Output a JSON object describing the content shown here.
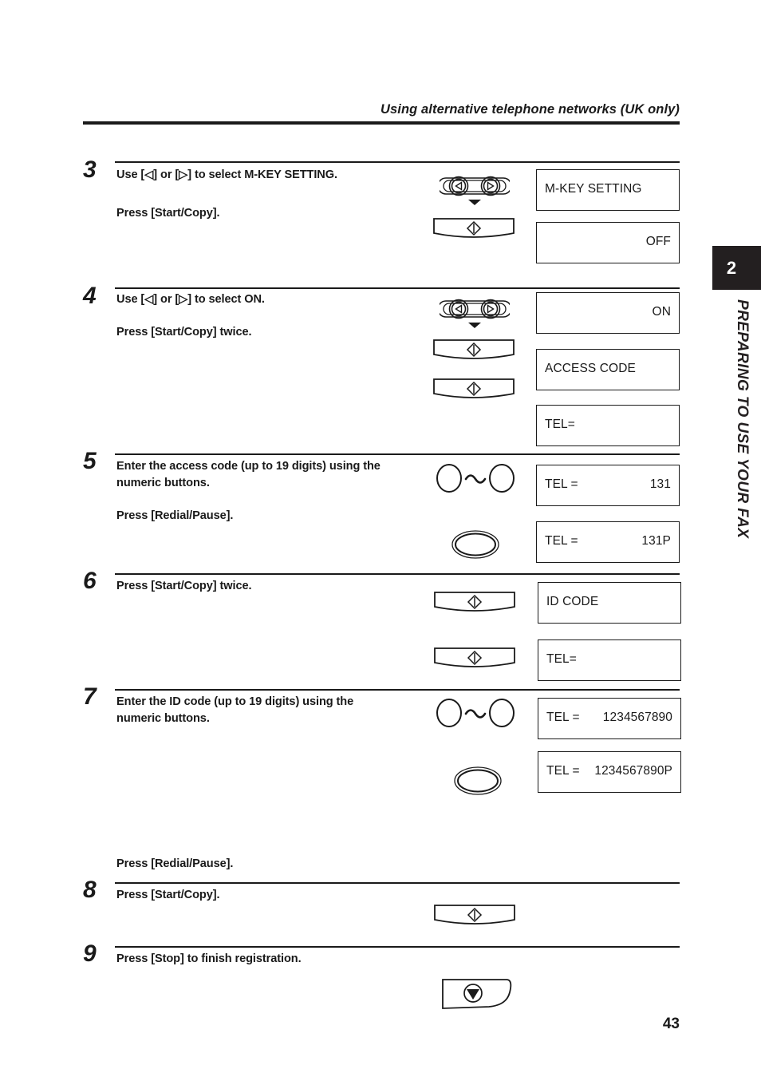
{
  "header": {
    "title": "Using alternative telephone networks (UK only)"
  },
  "side_tab": {
    "chapter_number": "2",
    "chapter_label": "PREPARING TO USE YOUR FAX"
  },
  "footer": {
    "page_number": "43"
  },
  "steps": [
    {
      "number": "3",
      "lines": [
        "Use [◁] or [▷] to select M-KEY SETTING.",
        "Press [Start/Copy]."
      ],
      "buttons": [
        "arrow-keys",
        "start-copy"
      ],
      "lcds": [
        {
          "left": "M-KEY SETTING",
          "right": ""
        },
        {
          "left": "",
          "right": "OFF"
        }
      ]
    },
    {
      "number": "4",
      "lines": [
        "Use [◁] or [▷] to select ON.",
        "Press [Start/Copy] twice."
      ],
      "buttons": [
        "arrow-keys",
        "start-copy",
        "start-copy"
      ],
      "lcds": [
        {
          "left": "",
          "right": "ON"
        },
        {
          "left": "ACCESS CODE",
          "right": ""
        },
        {
          "left": "TEL=",
          "right": ""
        }
      ]
    },
    {
      "number": "5",
      "lines": [
        "Enter the access code (up to 19 digits) using the",
        "numeric buttons.",
        "Press [Redial/Pause]."
      ],
      "buttons": [
        "numeric-keys",
        "redial-pause"
      ],
      "lcds": [
        {
          "left": "TEL =",
          "right": "131"
        },
        {
          "left": "TEL =",
          "right": "131P"
        }
      ]
    },
    {
      "number": "6",
      "lines": [
        "Press [Start/Copy] twice."
      ],
      "buttons": [
        "start-copy",
        "start-copy"
      ],
      "lcds": [
        {
          "left": "ID CODE",
          "right": ""
        },
        {
          "left": "TEL=",
          "right": ""
        }
      ]
    },
    {
      "number": "7",
      "lines": [
        "Enter the ID code (up to 19 digits) using the",
        "numeric buttons.",
        "Press [Redial/Pause]."
      ],
      "buttons": [
        "numeric-keys",
        "redial-pause"
      ],
      "lcds": [
        {
          "left": "TEL =",
          "right": "1234567890"
        },
        {
          "left": "TEL =",
          "right": "1234567890P"
        }
      ]
    },
    {
      "number": "8",
      "lines": [
        "Press [Start/Copy]."
      ],
      "buttons": [
        "start-copy"
      ],
      "lcds": []
    },
    {
      "number": "9",
      "lines": [
        "Press [Stop] to finish registration."
      ],
      "buttons": [
        "stop"
      ],
      "lcds": []
    }
  ]
}
